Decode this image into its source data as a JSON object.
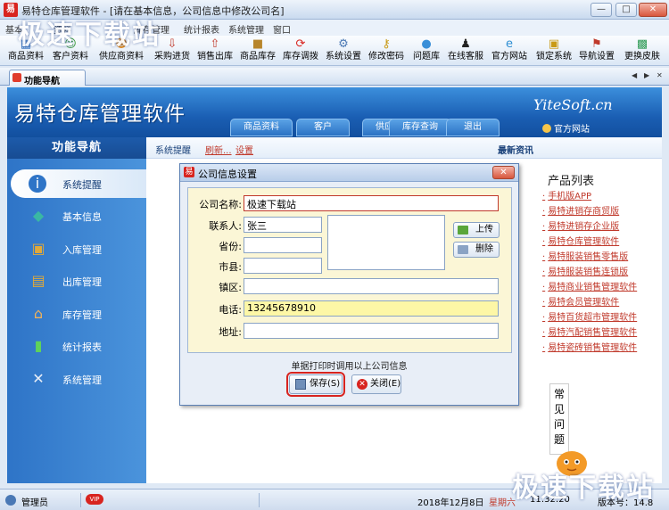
{
  "window": {
    "title": "易特仓库管理软件 - [请在基本信息，公司信息中修改公司名]",
    "app_icon_char": "易",
    "controls": [
      "—",
      "□",
      "✕"
    ]
  },
  "menu": [
    "基本",
    "资料",
    "库存管理",
    "统计报表",
    "系统管理",
    "窗口"
  ],
  "toolbar": [
    {
      "label": "商品资料",
      "icon": "product-icon"
    },
    {
      "label": "客户资料",
      "icon": "customer-icon"
    },
    {
      "label": "供应商资料",
      "icon": "supplier-icon"
    },
    {
      "label": "采购进货",
      "icon": "purchase-icon"
    },
    {
      "label": "销售出库",
      "icon": "sales-icon"
    },
    {
      "label": "商品库存",
      "icon": "stock-icon"
    },
    {
      "label": "库存调拨",
      "icon": "transfer-icon"
    },
    {
      "label": "系统设置",
      "icon": "settings-icon"
    },
    {
      "label": "修改密码",
      "icon": "key-icon"
    },
    {
      "label": "问题库",
      "icon": "question-icon"
    },
    {
      "label": "在线客服",
      "icon": "support-icon"
    },
    {
      "label": "官方网站",
      "icon": "web-icon"
    },
    {
      "label": "锁定系统",
      "icon": "lock-icon"
    },
    {
      "label": "导航设置",
      "icon": "nav-icon"
    },
    {
      "label": "更换皮肤",
      "icon": "skin-icon"
    }
  ],
  "tab": {
    "label": "功能导航",
    "controls": [
      "◀",
      "▶",
      "✕"
    ]
  },
  "banner": {
    "title": "易特仓库管理软件",
    "tabs": [
      "商品资料",
      "客户",
      "供应商",
      "库存查询",
      "退出"
    ],
    "brand": "YiteSoft.cn",
    "site_link": "官方网站"
  },
  "sidebar": {
    "header": "功能导航",
    "items": [
      {
        "label": "系统提醒",
        "icon": "info-icon",
        "active": true
      },
      {
        "label": "基本信息",
        "icon": "cube-icon"
      },
      {
        "label": "入库管理",
        "icon": "inbound-box-icon"
      },
      {
        "label": "出库管理",
        "icon": "outbound-box-icon"
      },
      {
        "label": "库存管理",
        "icon": "warehouse-icon"
      },
      {
        "label": "统计报表",
        "icon": "bar-chart-icon"
      },
      {
        "label": "系统管理",
        "icon": "tools-icon"
      }
    ]
  },
  "content": {
    "bar": {
      "reminder": "系统提醒",
      "refresh": "刷新...",
      "settings": "设置",
      "latest_news": "最新资讯"
    },
    "product_list_title": "产品列表",
    "products": [
      "手机版APP",
      "易特进销存商贸版",
      "易特进销存企业版",
      "易特仓库管理软件",
      "易特服装销售零售版",
      "易特服装销售连锁版",
      "易特商业销售管理软件",
      "易特会员管理软件",
      "易特百货超市管理软件",
      "易特汽配销售管理软件",
      "易特瓷砖销售管理软件"
    ],
    "faq_chars": [
      "常",
      "见",
      "问",
      "题"
    ]
  },
  "dialog": {
    "title": "公司信息设置",
    "close": "✕",
    "fields": {
      "company_name": {
        "label": "公司名称:",
        "value": "极速下载站"
      },
      "contact": {
        "label": "联系人:",
        "value": "张三"
      },
      "province": {
        "label": "省份:",
        "value": ""
      },
      "city": {
        "label": "市县:",
        "value": ""
      },
      "district": {
        "label": "镇区:",
        "value": ""
      },
      "phone": {
        "label": "电话:",
        "value": "13245678910"
      },
      "address": {
        "label": "地址:",
        "value": ""
      }
    },
    "upload": "上传",
    "delete": "删除",
    "hint": "单据打印时调用以上公司信息",
    "save": "保存(S)",
    "close_btn": "关闭(E)"
  },
  "statusbar": {
    "user": "管理员",
    "date": "2018年12月8日",
    "weekday": "星期六",
    "time": "11:32:20",
    "version": "版本号：14.8"
  },
  "watermark": "极速下载站",
  "colors": {
    "accent_blue": "#1a5eb3",
    "link_red": "#c0392b",
    "highlight_yellow": "#fdf7a6"
  }
}
